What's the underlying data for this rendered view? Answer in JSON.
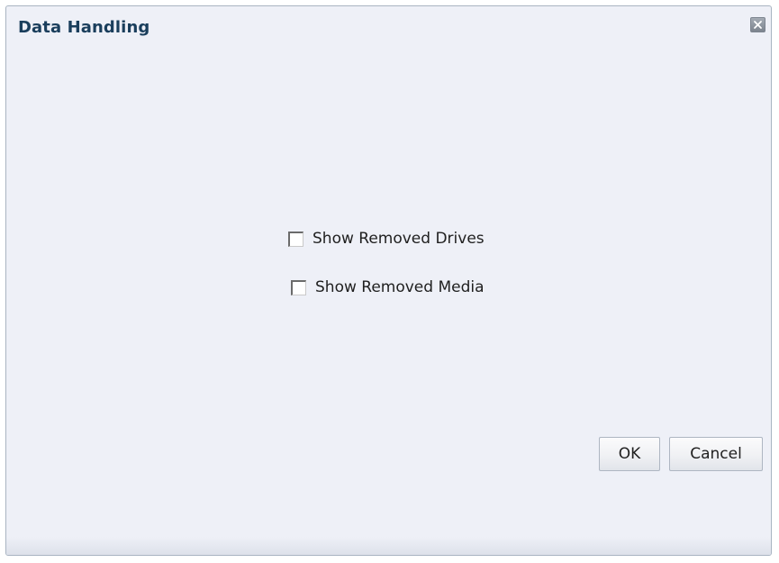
{
  "dialog": {
    "title": "Data Handling",
    "close_icon": "close-icon"
  },
  "options": [
    {
      "label": "Show Removed Drives",
      "checked": false
    },
    {
      "label": "Show Removed Media",
      "checked": false
    }
  ],
  "buttons": {
    "ok_label": "OK",
    "cancel_label": "Cancel"
  },
  "colors": {
    "title": "#1a3e5c",
    "background": "#eef0f7",
    "border": "#a9b4c2"
  }
}
